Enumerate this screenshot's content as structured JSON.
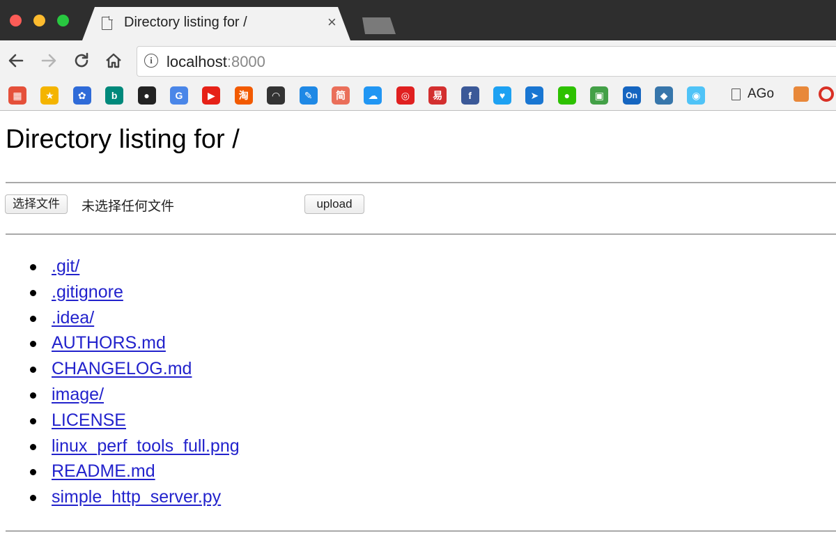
{
  "tab": {
    "title": "Directory listing for /",
    "close": "×"
  },
  "toolbar": {
    "url_host": "localhost",
    "url_port": ":8000"
  },
  "bookmarks": {
    "items": [
      {
        "icon": "apps-icon",
        "glyph": "▦",
        "color": "#e5503a"
      },
      {
        "icon": "star-icon",
        "glyph": "★",
        "color": "#f4b400"
      },
      {
        "icon": "baidu-icon",
        "glyph": "✿",
        "color": "#2f6bd8"
      },
      {
        "icon": "bing-icon",
        "glyph": "b",
        "color": "#00897b"
      },
      {
        "icon": "github-icon",
        "glyph": "●",
        "color": "#222222"
      },
      {
        "icon": "google-translate-icon",
        "glyph": "G",
        "color": "#4a86e8"
      },
      {
        "icon": "youtube-icon",
        "glyph": "▶",
        "color": "#e62117"
      },
      {
        "icon": "taobao-icon",
        "glyph": "淘",
        "color": "#f25a00"
      },
      {
        "icon": "hat-icon",
        "glyph": "◠",
        "color": "#333333"
      },
      {
        "icon": "pencil-icon",
        "glyph": "✎",
        "color": "#1e88e5"
      },
      {
        "icon": "jianshu-icon",
        "glyph": "简",
        "color": "#ea6f5a"
      },
      {
        "icon": "cloud-icon",
        "glyph": "☁",
        "color": "#2196f3"
      },
      {
        "icon": "netease-music-icon",
        "glyph": "◎",
        "color": "#e02020"
      },
      {
        "icon": "netease-icon",
        "glyph": "易",
        "color": "#d32f2f"
      },
      {
        "icon": "facebook-icon",
        "glyph": "f",
        "color": "#3b5998"
      },
      {
        "icon": "twitter-icon",
        "glyph": "♥",
        "color": "#1da1f2"
      },
      {
        "icon": "feather-icon",
        "glyph": "➤",
        "color": "#1976d2"
      },
      {
        "icon": "wechat-icon",
        "glyph": "●",
        "color": "#2dc100"
      },
      {
        "icon": "maze-icon",
        "glyph": "▣",
        "color": "#43a047"
      },
      {
        "icon": "on-icon",
        "glyph": "On",
        "color": "#1565c0"
      },
      {
        "icon": "python-icon",
        "glyph": "◆",
        "color": "#3776ab"
      },
      {
        "icon": "gopher-icon",
        "glyph": "◉",
        "color": "#4fc3f7"
      }
    ],
    "ago_label": "AGo"
  },
  "page": {
    "heading": "Directory listing for /",
    "choose_file_label": "选择文件",
    "no_file_label": "未选择任何文件",
    "upload_label": "upload",
    "files": [
      ".git/",
      ".gitignore",
      ".idea/",
      "AUTHORS.md",
      "CHANGELOG.md",
      "image/",
      "LICENSE",
      "linux_perf_tools_full.png",
      "README.md",
      "simple_http_server.py"
    ]
  }
}
